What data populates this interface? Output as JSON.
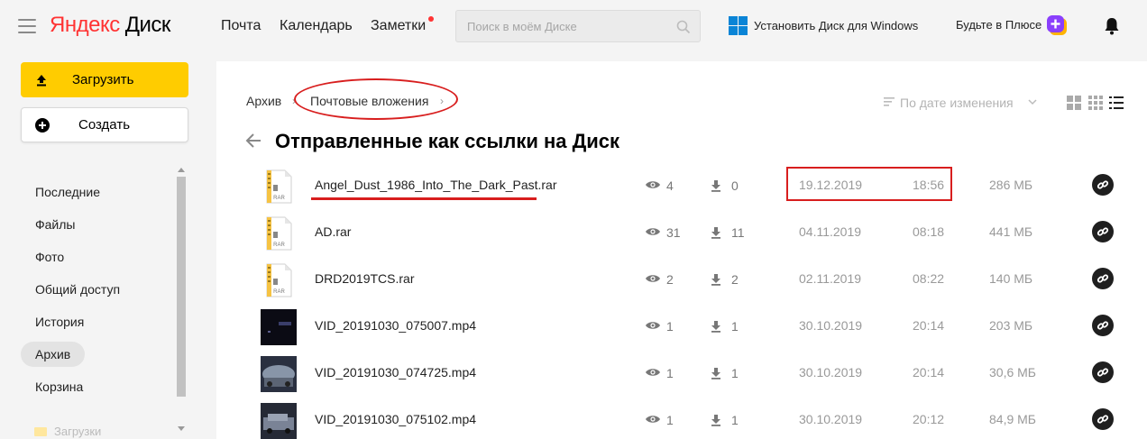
{
  "header": {
    "logo_brand": "Яндекс",
    "logo_product": "Диск",
    "nav": [
      {
        "label": "Почта"
      },
      {
        "label": "Календарь"
      },
      {
        "label": "Заметки"
      }
    ],
    "search_placeholder": "Поиск в моём Диске",
    "install_label": "Установить Диск для Windows",
    "plus_label": "Будьте в Плюсе"
  },
  "sidebar": {
    "upload_label": "Загрузить",
    "create_label": "Создать",
    "items": [
      {
        "label": "Последние"
      },
      {
        "label": "Файлы"
      },
      {
        "label": "Фото"
      },
      {
        "label": "Общий доступ"
      },
      {
        "label": "История"
      },
      {
        "label": "Архив"
      },
      {
        "label": "Корзина"
      }
    ],
    "faded_item": "Загрузки"
  },
  "main": {
    "breadcrumbs": [
      "Архив",
      "Почтовые вложения"
    ],
    "sort_label": "По дате изменения",
    "title": "Отправленные как ссылки на Диск",
    "files": [
      {
        "name": "Angel_Dust_1986_Into_The_Dark_Past.rar",
        "type": "rar",
        "views": "4",
        "downloads": "0",
        "date": "19.12.2019",
        "time": "18:56",
        "size": "286 МБ"
      },
      {
        "name": "AD.rar",
        "type": "rar",
        "views": "31",
        "downloads": "11",
        "date": "04.11.2019",
        "time": "08:18",
        "size": "441 МБ"
      },
      {
        "name": "DRD2019TCS.rar",
        "type": "rar",
        "views": "2",
        "downloads": "2",
        "date": "02.11.2019",
        "time": "08:22",
        "size": "140 МБ"
      },
      {
        "name": "VID_20191030_075007.mp4",
        "type": "video",
        "views": "1",
        "downloads": "1",
        "date": "30.10.2019",
        "time": "20:14",
        "size": "203 МБ"
      },
      {
        "name": "VID_20191030_074725.mp4",
        "type": "video",
        "views": "1",
        "downloads": "1",
        "date": "30.10.2019",
        "time": "20:14",
        "size": "30,6 МБ"
      },
      {
        "name": "VID_20191030_075102.mp4",
        "type": "video",
        "views": "1",
        "downloads": "1",
        "date": "30.10.2019",
        "time": "20:12",
        "size": "84,9 МБ"
      }
    ]
  },
  "colors": {
    "accent_yellow": "#ffcc00",
    "annotation_red": "#d81e1e",
    "logo_red": "#ff3333"
  }
}
